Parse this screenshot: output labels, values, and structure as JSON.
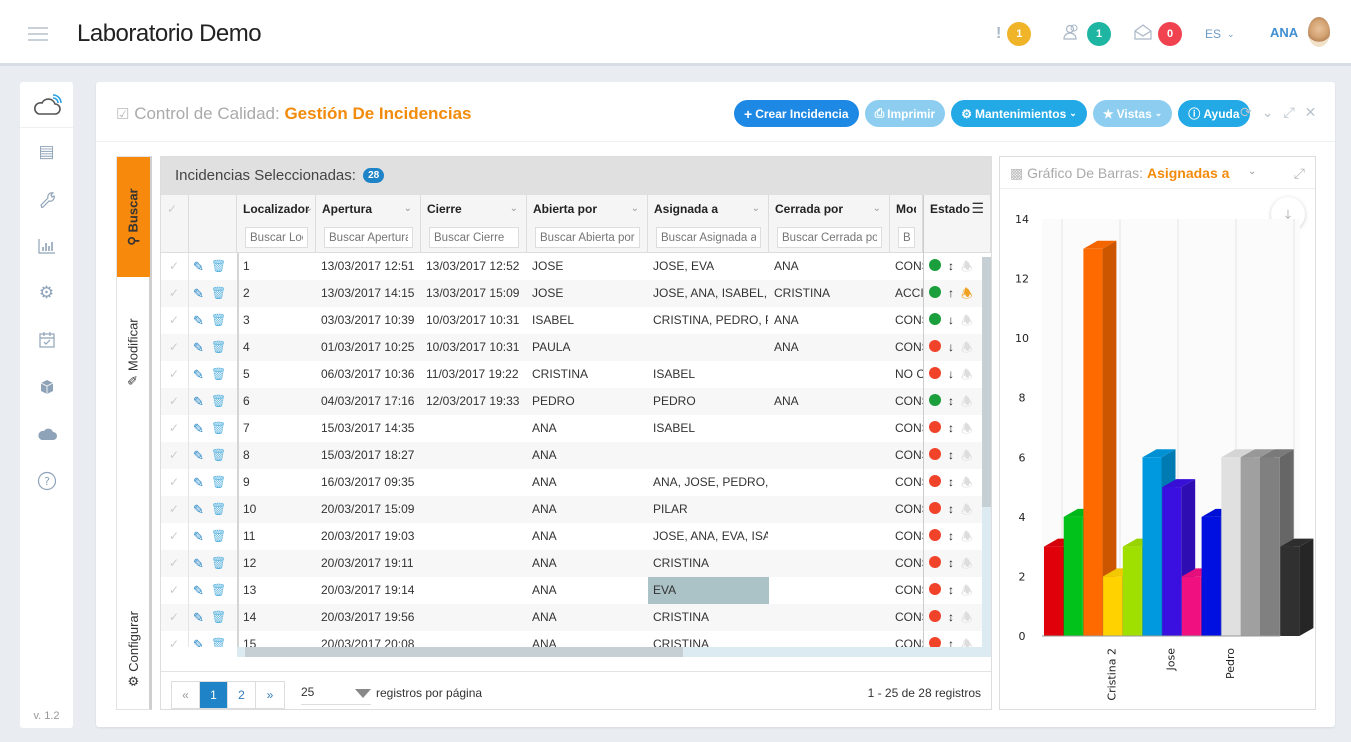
{
  "header": {
    "app_title": "Laboratorio Demo",
    "alerts_count": "1",
    "users_count": "1",
    "messages_count": "0",
    "language": "ES",
    "user_name": "ANA",
    "colors": {
      "alerts": "#f0b429",
      "users": "#1fb5a3",
      "messages": "#f0434f"
    }
  },
  "sidebar": {
    "items": [
      {
        "icon": "cloud-wifi-icon"
      },
      {
        "icon": "news-icon"
      },
      {
        "icon": "wrench-icon"
      },
      {
        "icon": "bar-chart-icon"
      },
      {
        "icon": "gear-icon"
      },
      {
        "icon": "calendar-check-icon"
      },
      {
        "icon": "cube-icon"
      },
      {
        "icon": "cloud-icon"
      },
      {
        "icon": "help-icon"
      }
    ],
    "version": "v. 1.2"
  },
  "panel": {
    "title_prefix": "Control de Calidad:",
    "title_accent": "Gestión De Incidencias",
    "buttons": {
      "create": "Crear Incidencia",
      "print": "Imprimir",
      "maintenance": "Mantenimientos",
      "views": "Vistas",
      "help": "Ayuda"
    }
  },
  "vtabs": {
    "search": "Buscar",
    "modify": "Modificar",
    "configure": "Configurar"
  },
  "grid": {
    "title": "Incidencias Seleccionadas:",
    "count": "28",
    "columns": [
      {
        "label": "Localizador",
        "placeholder": "Buscar Localizador"
      },
      {
        "label": "Apertura",
        "placeholder": "Buscar Apertura"
      },
      {
        "label": "Cierre",
        "placeholder": "Buscar Cierre"
      },
      {
        "label": "Abierta por",
        "placeholder": "Buscar Abierta por"
      },
      {
        "label": "Asignada a",
        "placeholder": "Buscar Asignada a"
      },
      {
        "label": "Cerrada por",
        "placeholder": "Buscar Cerrada por"
      },
      {
        "label": "Modalidad",
        "placeholder": "Buscar Modalidad"
      },
      {
        "label": "Estado"
      }
    ],
    "rows": [
      {
        "loc": "1",
        "apertura": "13/03/2017 12:51",
        "cierre": "13/03/2017 12:52",
        "abierta": "JOSE",
        "asignada": "JOSE, EVA",
        "cerrada": "ANA",
        "modalidad": "CONS",
        "status": "green",
        "priority": "both",
        "bell": "off"
      },
      {
        "loc": "2",
        "apertura": "13/03/2017 14:15",
        "cierre": "13/03/2017 15:09",
        "abierta": "JOSE",
        "asignada": "JOSE, ANA, ISABEL, ...",
        "cerrada": "CRISTINA",
        "modalidad": "ACCIO",
        "status": "green",
        "priority": "up",
        "bell": "on"
      },
      {
        "loc": "3",
        "apertura": "03/03/2017 10:39",
        "cierre": "10/03/2017 10:31",
        "abierta": "ISABEL",
        "asignada": "CRISTINA, PEDRO, P...",
        "cerrada": "ANA",
        "modalidad": "CONS",
        "status": "green",
        "priority": "down",
        "bell": "off"
      },
      {
        "loc": "4",
        "apertura": "01/03/2017 10:25",
        "cierre": "10/03/2017 10:31",
        "abierta": "PAULA",
        "asignada": "",
        "cerrada": "ANA",
        "modalidad": "CONS",
        "status": "red",
        "priority": "down",
        "bell": "off"
      },
      {
        "loc": "5",
        "apertura": "06/03/2017 10:36",
        "cierre": "11/03/2017 19:22",
        "abierta": "CRISTINA",
        "asignada": "ISABEL",
        "cerrada": "",
        "modalidad": "NO CO",
        "status": "red",
        "priority": "down",
        "bell": "off"
      },
      {
        "loc": "6",
        "apertura": "04/03/2017 17:16",
        "cierre": "12/03/2017 19:33",
        "abierta": "PEDRO",
        "asignada": "PEDRO",
        "cerrada": "ANA",
        "modalidad": "CONS",
        "status": "green",
        "priority": "both",
        "bell": "off"
      },
      {
        "loc": "7",
        "apertura": "15/03/2017 14:35",
        "cierre": "",
        "abierta": "ANA",
        "asignada": "ISABEL",
        "cerrada": "",
        "modalidad": "CONS",
        "status": "red",
        "priority": "both",
        "bell": "off"
      },
      {
        "loc": "8",
        "apertura": "15/03/2017 18:27",
        "cierre": "",
        "abierta": "ANA",
        "asignada": "",
        "cerrada": "",
        "modalidad": "CONS",
        "status": "red",
        "priority": "both",
        "bell": "off"
      },
      {
        "loc": "9",
        "apertura": "16/03/2017 09:35",
        "cierre": "",
        "abierta": "ANA",
        "asignada": "ANA, JOSE, PEDRO, ...",
        "cerrada": "",
        "modalidad": "CONS",
        "status": "red",
        "priority": "both",
        "bell": "off"
      },
      {
        "loc": "10",
        "apertura": "20/03/2017 15:09",
        "cierre": "",
        "abierta": "ANA",
        "asignada": "PILAR",
        "cerrada": "",
        "modalidad": "CONS",
        "status": "red",
        "priority": "both",
        "bell": "off"
      },
      {
        "loc": "11",
        "apertura": "20/03/2017 19:03",
        "cierre": "",
        "abierta": "ANA",
        "asignada": "JOSE, ANA, EVA, ISA...",
        "cerrada": "",
        "modalidad": "CONS",
        "status": "red",
        "priority": "both",
        "bell": "off"
      },
      {
        "loc": "12",
        "apertura": "20/03/2017 19:11",
        "cierre": "",
        "abierta": "ANA",
        "asignada": "CRISTINA",
        "cerrada": "",
        "modalidad": "CONS",
        "status": "red",
        "priority": "both",
        "bell": "off"
      },
      {
        "loc": "13",
        "apertura": "20/03/2017 19:14",
        "cierre": "",
        "abierta": "ANA",
        "asignada": "EVA",
        "cerrada": "",
        "modalidad": "CONS",
        "status": "red",
        "priority": "both",
        "bell": "off",
        "selected_cell": "asignada"
      },
      {
        "loc": "14",
        "apertura": "20/03/2017 19:56",
        "cierre": "",
        "abierta": "ANA",
        "asignada": "CRISTINA",
        "cerrada": "",
        "modalidad": "CONS",
        "status": "red",
        "priority": "both",
        "bell": "off"
      },
      {
        "loc": "15",
        "apertura": "20/03/2017 20:08",
        "cierre": "",
        "abierta": "ANA",
        "asignada": "CRISTINA",
        "cerrada": "",
        "modalidad": "CONS",
        "status": "red",
        "priority": "up",
        "bell": "off"
      }
    ],
    "status_colors": {
      "green": "#1a9f3c",
      "red": "#f0432a"
    },
    "pagination": {
      "first": "«",
      "pages": [
        "1",
        "2"
      ],
      "current": "1",
      "last": "»",
      "page_size": "25",
      "page_size_label": "registros por página",
      "info": "1 - 25 de 28 registros"
    }
  },
  "chart_panel": {
    "title_prefix": "Gráfico De Barras:",
    "title_accent": "Asignadas a"
  },
  "chart_data": {
    "type": "bar",
    "title": "Gráfico De Barras: Asignadas a",
    "xlabel": "",
    "ylabel": "",
    "ylim": [
      0,
      14
    ],
    "yticks": [
      0,
      2,
      4,
      6,
      8,
      10,
      12,
      14
    ],
    "grid": true,
    "categories": [
      "",
      "",
      "",
      "Cristina 2",
      "",
      "",
      "Jose",
      "",
      "",
      "Pedro",
      "",
      "",
      ""
    ],
    "values": [
      3,
      4,
      13,
      2,
      3,
      6,
      5,
      2,
      4,
      6,
      6,
      6,
      3
    ],
    "colors": [
      "#e0000a",
      "#00c21a",
      "#ff6a00",
      "#ffd200",
      "#a0e000",
      "#0099e0",
      "#3a10e0",
      "#f01080",
      "#0010e0",
      "#e0e0e0",
      "#a0a0a0",
      "#808080",
      "#303030"
    ]
  }
}
